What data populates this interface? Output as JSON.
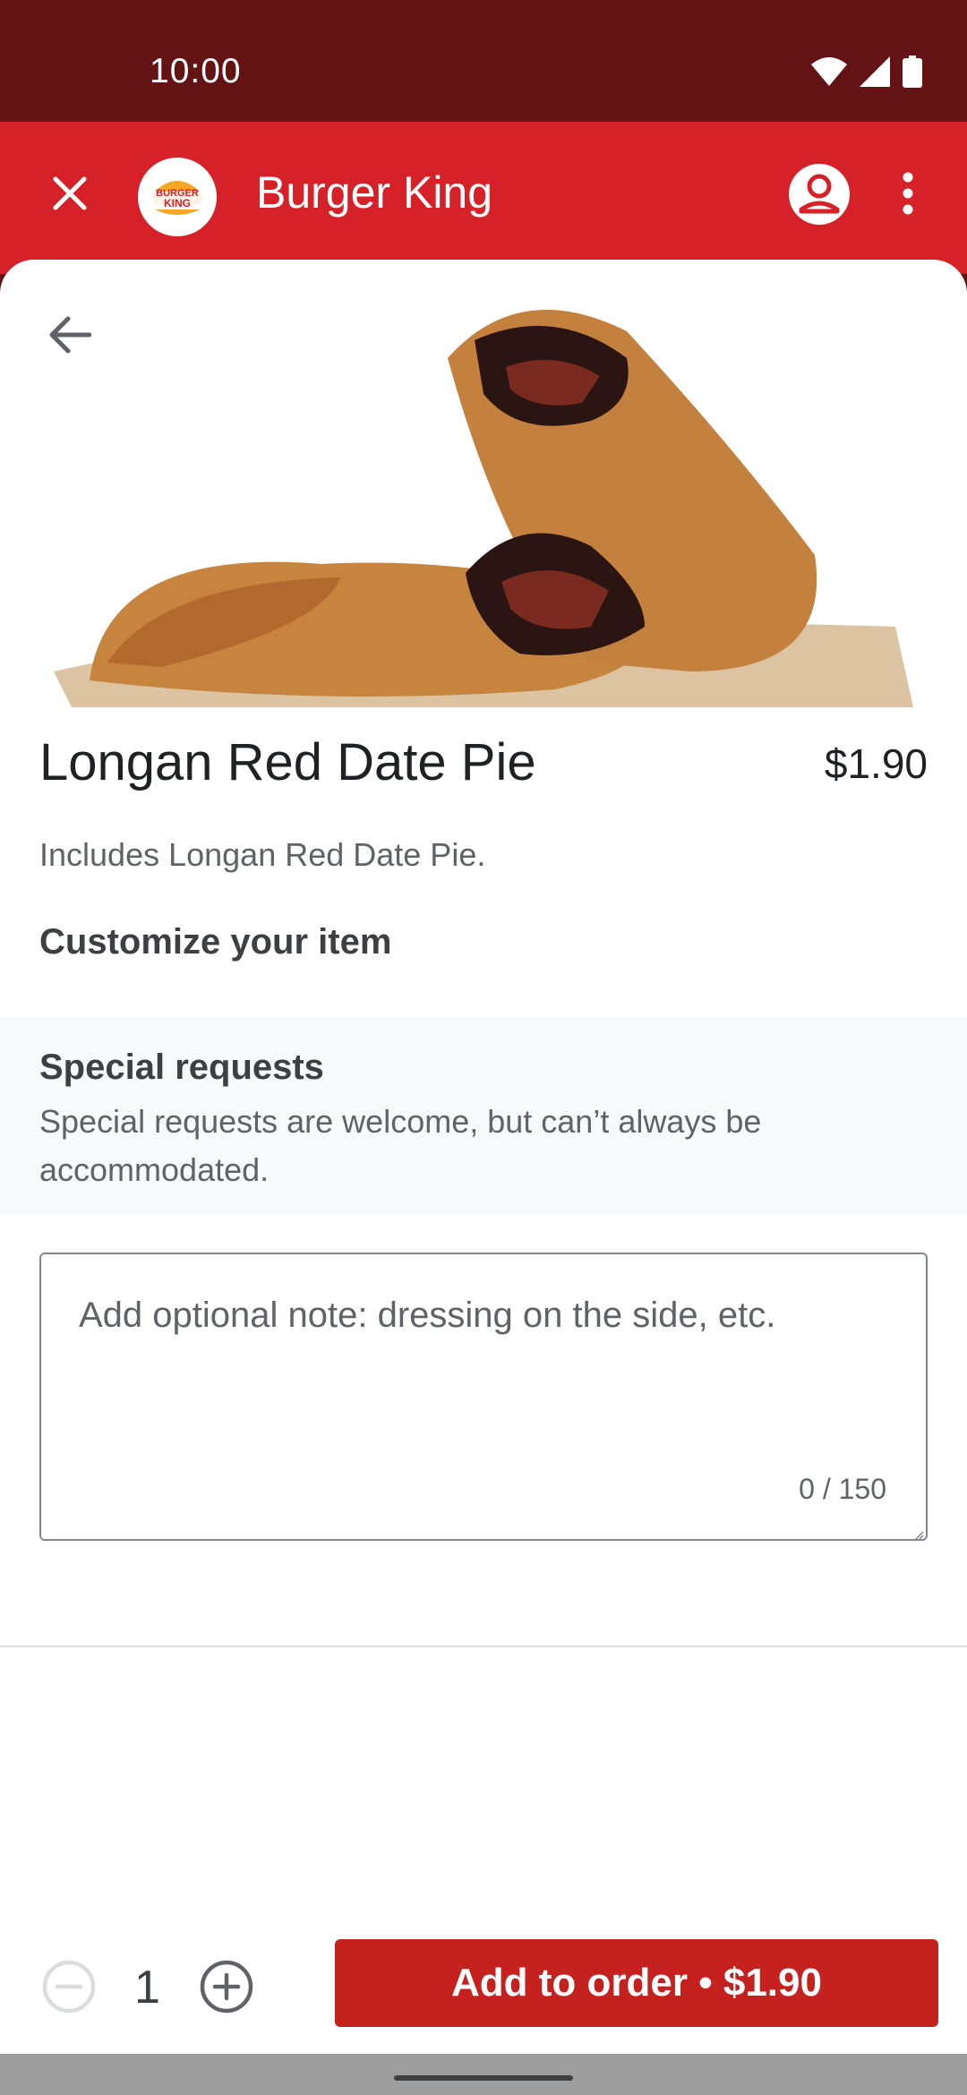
{
  "status_bar": {
    "time": "10:00",
    "icons": [
      "wifi-icon",
      "signal-icon",
      "battery-icon"
    ]
  },
  "app_bar": {
    "title": "Burger King",
    "logo_text_top": "BURGER",
    "logo_text_bottom": "KING",
    "icons": [
      "close-icon",
      "account-icon",
      "more-vert-icon"
    ]
  },
  "item": {
    "name": "Longan Red Date Pie",
    "price": "$1.90",
    "description": "Includes Longan Red Date Pie.",
    "customize_heading": "Customize your item"
  },
  "special_requests": {
    "title": "Special requests",
    "subtitle": "Special requests are welcome, but can’t always be accommodated.",
    "placeholder": "Add optional note: dressing on the side, etc.",
    "value": "",
    "counter": "0 / 150"
  },
  "order": {
    "quantity": "1",
    "add_button_label": "Add to order • $1.90"
  },
  "colors": {
    "status_bar": "#641314",
    "app_bar": "#d62128",
    "add_button": "#c5221f"
  }
}
